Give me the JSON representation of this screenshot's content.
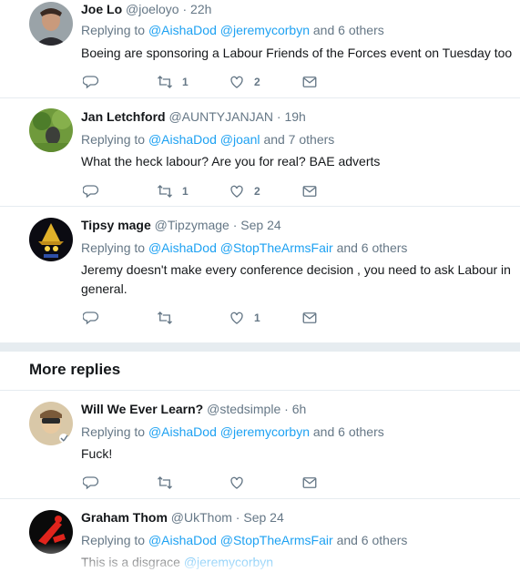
{
  "colors": {
    "link": "#1da1f2",
    "muted": "#657786",
    "text": "#14171a",
    "divider": "#e6ecf0"
  },
  "tweets": [
    {
      "name": "Joe Lo",
      "handle": "@joeloyo",
      "sep": "·",
      "time": "22h",
      "reply_prefix": "Replying to",
      "mention1": "@AishaDod",
      "mention2": "@jeremycorbyn",
      "reply_suffix": "and 6 others",
      "text": "Boeing are sponsoring a Labour Friends of the Forces event on Tuesday too",
      "counts": {
        "reply": "",
        "retweet": "1",
        "like": "2"
      }
    },
    {
      "name": "Jan Letchford",
      "handle": "@AUNTYJANJAN",
      "sep": "·",
      "time": "19h",
      "reply_prefix": "Replying to",
      "mention1": "@AishaDod",
      "mention2": "@joanl",
      "reply_suffix": "and 7 others",
      "text": "What the heck labour?  Are you for real? BAE adverts",
      "counts": {
        "reply": "",
        "retweet": "1",
        "like": "2"
      }
    },
    {
      "name": "Tipsy mage",
      "handle": "@Tipzymage",
      "sep": "·",
      "time": "Sep 24",
      "reply_prefix": "Replying to",
      "mention1": "@AishaDod",
      "mention2": "@StopTheArmsFair",
      "reply_suffix": "and 6 others",
      "text": "Jeremy doesn't make every conference decision , you need to ask Labour in general.",
      "counts": {
        "reply": "",
        "retweet": "",
        "like": "1"
      }
    },
    {
      "name": "Will We Ever Learn?",
      "handle": "@stedsimple",
      "sep": "·",
      "time": "6h",
      "reply_prefix": "Replying to",
      "mention1": "@AishaDod",
      "mention2": "@jeremycorbyn",
      "reply_suffix": "and 6 others",
      "text": "Fuck!",
      "counts": {
        "reply": "",
        "retweet": "",
        "like": ""
      }
    },
    {
      "name": "Graham Thom",
      "handle": "@UkThom",
      "sep": "·",
      "time": "Sep 24",
      "reply_prefix": "Replying to",
      "mention1": "@AishaDod",
      "mention2": "@StopTheArmsFair",
      "reply_suffix": "and 6 others",
      "text_prefix": "This is a disgrace",
      "text_mention": "@jeremycorbyn"
    }
  ],
  "more_replies_title": "More replies",
  "icons": [
    "reply-icon",
    "retweet-icon",
    "like-icon",
    "message-icon"
  ]
}
